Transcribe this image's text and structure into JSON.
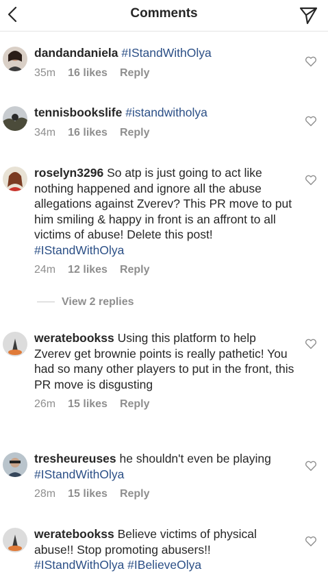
{
  "header": {
    "title": "Comments"
  },
  "comments": [
    {
      "username": "dandandaniela",
      "text": "",
      "hashtags": "#IStandWithOlya",
      "time": "35m",
      "likes": "16 likes",
      "reply": "Reply"
    },
    {
      "username": "tennisbookslife",
      "text": "",
      "hashtags": "#istandwitholya",
      "time": "34m",
      "likes": "16 likes",
      "reply": "Reply"
    },
    {
      "username": "roselyn3296",
      "text": "So atp is just going to act like nothing happened and ignore all the abuse allegations against Zverev? This PR move to put him smiling & happy in front is an affront to all victims of abuse! Delete this post!",
      "hashtags": "#IStandWithOlya",
      "time": "24m",
      "likes": "12 likes",
      "reply": "Reply",
      "view_replies": "View 2 replies"
    },
    {
      "username": "weratebookss",
      "text": "Using this platform to help Zverev get brownie points is really pathetic! You had so many other players to put in the front, this PR move is disgusting",
      "hashtags": "",
      "time": "26m",
      "likes": "15 likes",
      "reply": "Reply"
    },
    {
      "username": "tresheureuses",
      "text": "he shouldn't even be playing",
      "hashtags": "#IStandWithOlya",
      "time": "28m",
      "likes": "15 likes",
      "reply": "Reply"
    },
    {
      "username": "weratebookss",
      "text": "Believe victims of physical abuse!! Stop promoting abusers!!",
      "hashtags": "#IStandWithOlya #IBelieveOlya",
      "time": "",
      "likes": "",
      "reply": ""
    }
  ]
}
